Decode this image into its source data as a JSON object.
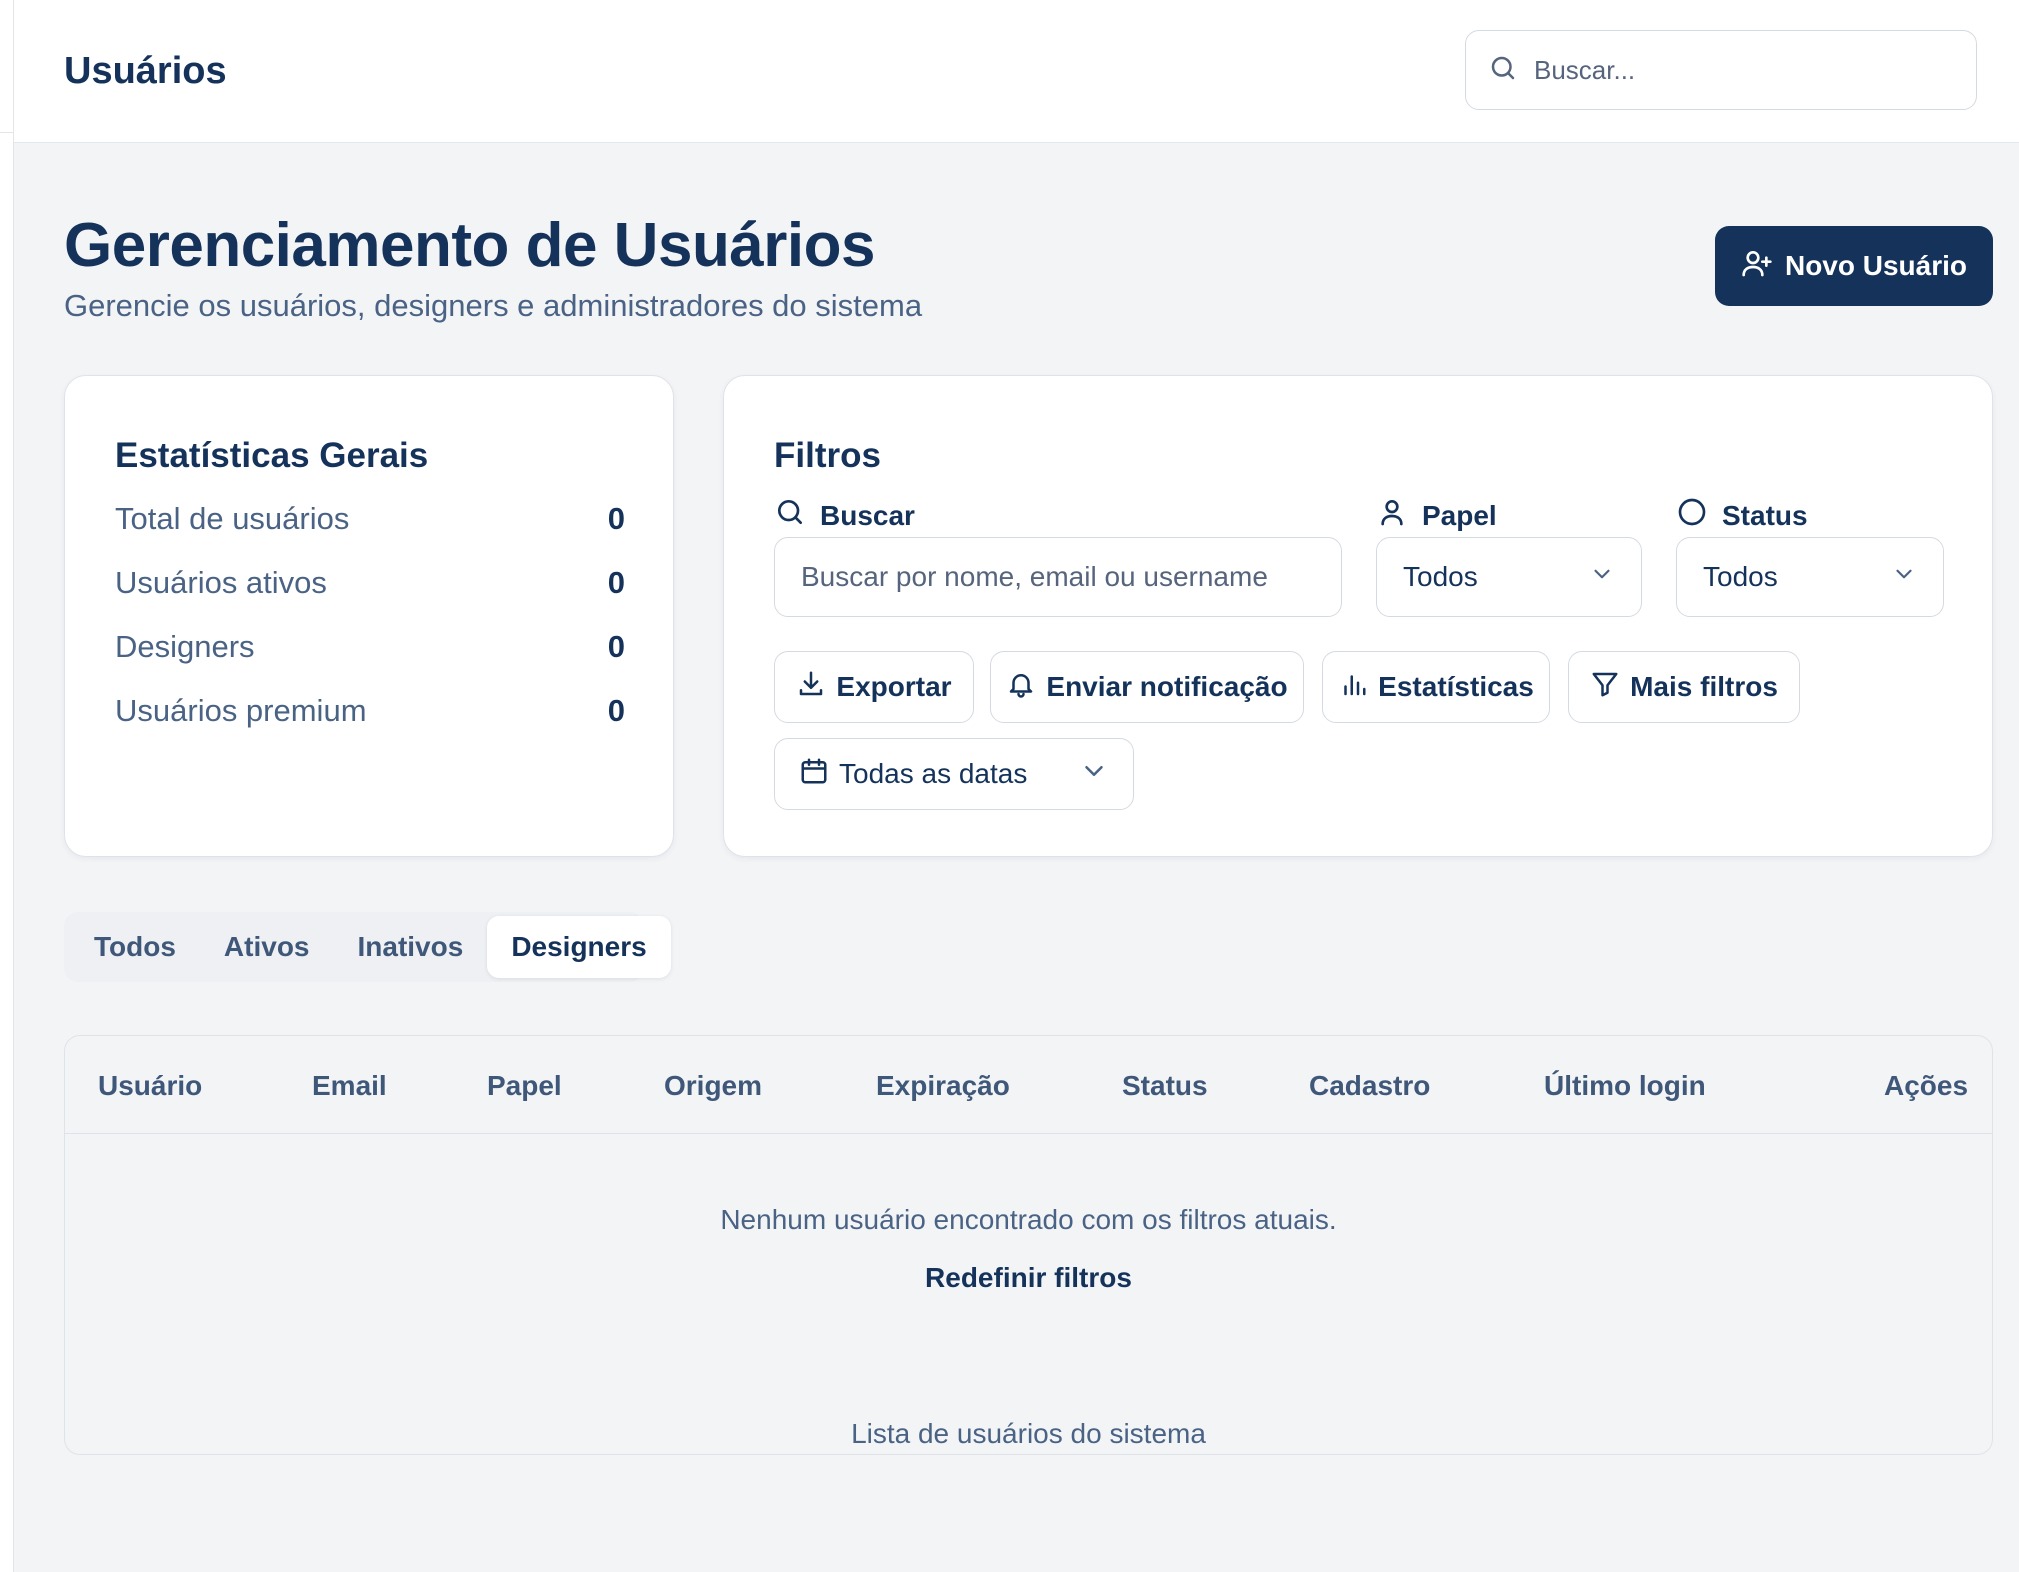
{
  "header": {
    "title": "Usuários",
    "search_placeholder": "Buscar..."
  },
  "page": {
    "title": "Gerenciamento de Usuários",
    "subtitle": "Gerencie os usuários, designers e administradores do sistema",
    "new_user_label": "Novo Usuário"
  },
  "stats": {
    "title": "Estatísticas Gerais",
    "rows": [
      {
        "label": "Total de usuários",
        "value": "0"
      },
      {
        "label": "Usuários ativos",
        "value": "0"
      },
      {
        "label": "Designers",
        "value": "0"
      },
      {
        "label": "Usuários premium",
        "value": "0"
      }
    ]
  },
  "filters": {
    "title": "Filtros",
    "search_label": "Buscar",
    "search_placeholder": "Buscar por nome, email ou username",
    "role_label": "Papel",
    "role_value": "Todos",
    "status_label": "Status",
    "status_value": "Todos",
    "actions": {
      "export": "Exportar",
      "notify": "Enviar notificação",
      "stats": "Estatísticas",
      "more": "Mais filtros"
    },
    "date_value": "Todas as datas"
  },
  "tabs": [
    {
      "label": "Todos"
    },
    {
      "label": "Ativos"
    },
    {
      "label": "Inativos"
    },
    {
      "label": "Designers",
      "active": true
    }
  ],
  "table": {
    "columns": [
      "Usuário",
      "Email",
      "Papel",
      "Origem",
      "Expiração",
      "Status",
      "Cadastro",
      "Último login",
      "Ações"
    ],
    "empty_message": "Nenhum usuário encontrado com os filtros atuais.",
    "reset_label": "Redefinir filtros",
    "caption": "Lista de usuários do sistema"
  },
  "colors": {
    "primary": "#14325a",
    "muted": "#4a6385",
    "background": "#f3f4f6",
    "border": "#dfe3e9"
  }
}
